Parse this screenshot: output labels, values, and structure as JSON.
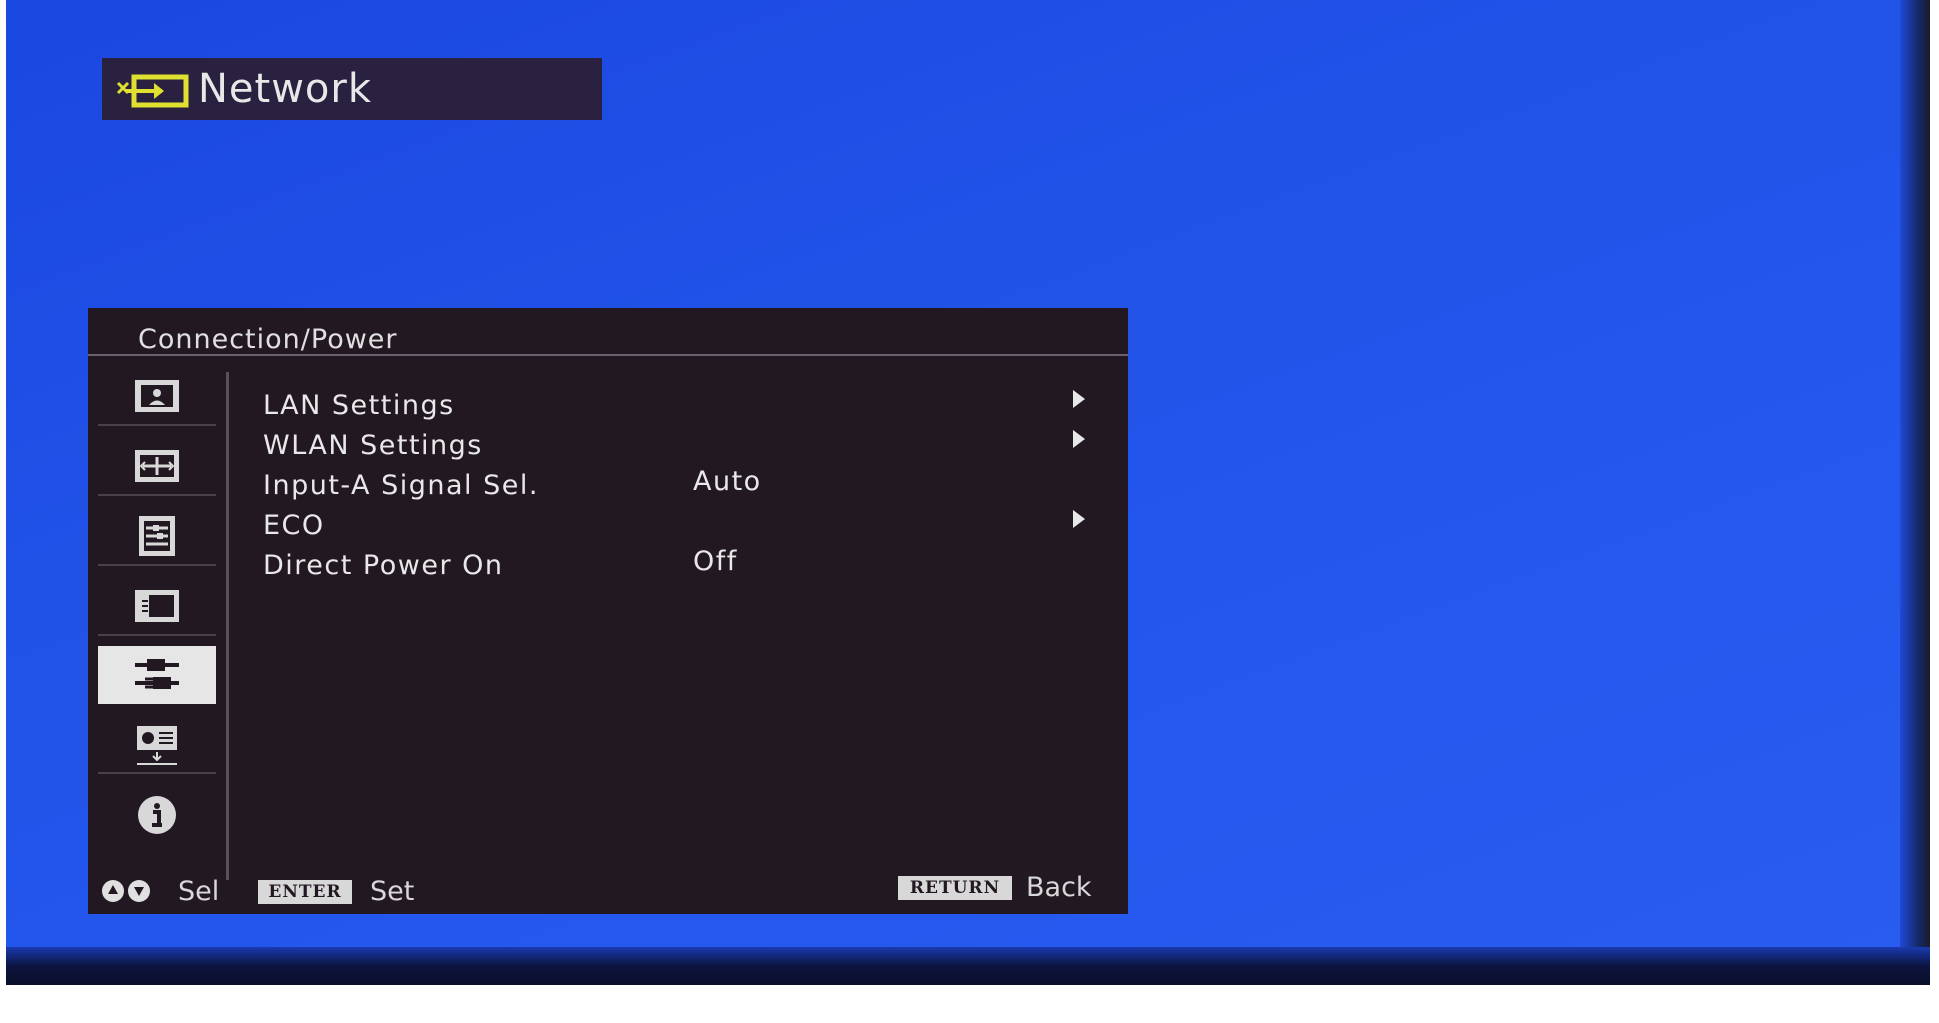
{
  "header": {
    "title": "Network",
    "icon": "network-input-icon"
  },
  "panel": {
    "title": "Connection/Power",
    "sidebar": [
      {
        "icon": "picture-icon",
        "active": false
      },
      {
        "icon": "screen-icon",
        "active": false
      },
      {
        "icon": "function-icon",
        "active": false
      },
      {
        "icon": "operation-icon",
        "active": false
      },
      {
        "icon": "connection-power-icon",
        "active": true
      },
      {
        "icon": "installation-icon",
        "active": false
      },
      {
        "icon": "information-icon",
        "active": false
      }
    ],
    "items": [
      {
        "label": "LAN Settings",
        "value": "",
        "has_submenu": true
      },
      {
        "label": "WLAN Settings",
        "value": "",
        "has_submenu": true
      },
      {
        "label": "Input-A Signal Sel.",
        "value": "Auto",
        "has_submenu": false
      },
      {
        "label": "ECO",
        "value": "",
        "has_submenu": true
      },
      {
        "label": "Direct Power On",
        "value": "Off",
        "has_submenu": false
      }
    ]
  },
  "footer": {
    "sel_label": "Sel",
    "enter_key": "ENTER",
    "set_label": "Set",
    "return_key": "RETURN",
    "back_label": "Back"
  },
  "colors": {
    "background": "#2152e8",
    "panel": "#221822",
    "header_box": "#2a2140",
    "icon_accent": "#e0e030"
  }
}
